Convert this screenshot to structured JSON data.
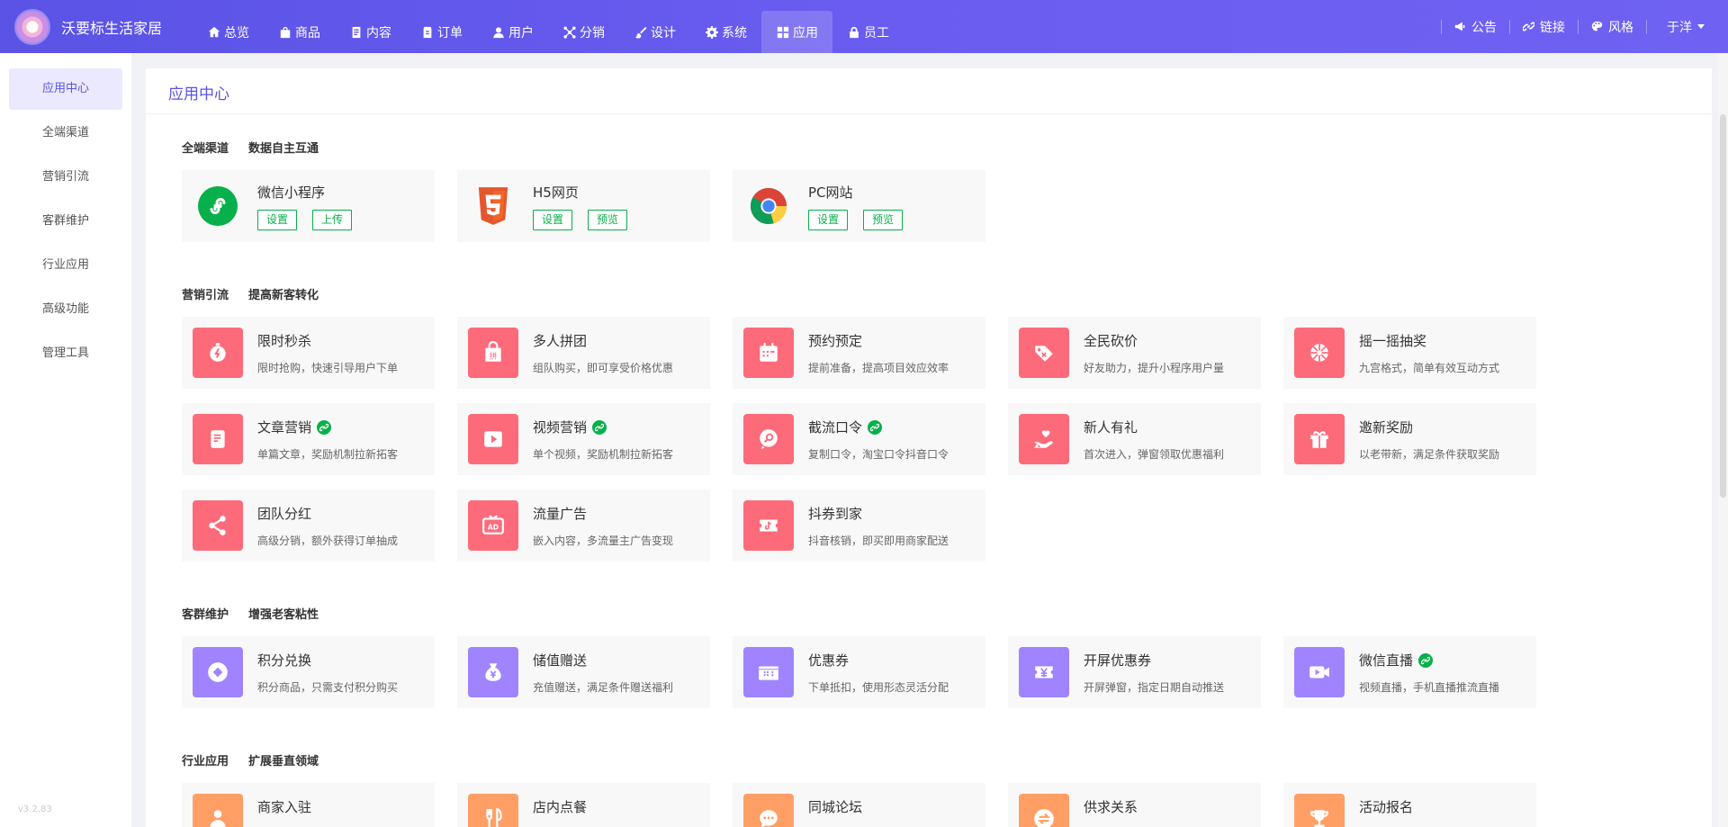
{
  "brand": {
    "name": "沃要标生活家居"
  },
  "nav": [
    {
      "label": "总览",
      "icon": "home-icon"
    },
    {
      "label": "商品",
      "icon": "bag-icon"
    },
    {
      "label": "内容",
      "icon": "document-icon"
    },
    {
      "label": "订单",
      "icon": "order-icon"
    },
    {
      "label": "用户",
      "icon": "user-icon"
    },
    {
      "label": "分销",
      "icon": "share-network-icon"
    },
    {
      "label": "设计",
      "icon": "brush-icon"
    },
    {
      "label": "系统",
      "icon": "gear-icon"
    },
    {
      "label": "应用",
      "icon": "grid-icon",
      "active": true
    },
    {
      "label": "员工",
      "icon": "lock-icon"
    }
  ],
  "tools": [
    {
      "label": "公告",
      "icon": "megaphone-icon"
    },
    {
      "label": "链接",
      "icon": "link-icon"
    },
    {
      "label": "风格",
      "icon": "palette-icon"
    }
  ],
  "user": {
    "name": "于洋"
  },
  "sidebar": {
    "items": [
      {
        "label": "应用中心",
        "active": true
      },
      {
        "label": "全端渠道"
      },
      {
        "label": "营销引流"
      },
      {
        "label": "客群维护"
      },
      {
        "label": "行业应用"
      },
      {
        "label": "高级功能"
      },
      {
        "label": "管理工具"
      }
    ],
    "version": "v3.2.83"
  },
  "panel": {
    "title": "应用中心"
  },
  "sections": [
    {
      "title": "全端渠道",
      "subtitle": "数据自主互通",
      "cards": [
        {
          "name": "微信小程序",
          "icon": "wechat-miniprogram-icon",
          "buttons": [
            "设置",
            "上传"
          ]
        },
        {
          "name": "H5网页",
          "icon": "html5-icon",
          "buttons": [
            "设置",
            "预览"
          ]
        },
        {
          "name": "PC网站",
          "icon": "chrome-icon",
          "buttons": [
            "设置",
            "预览"
          ]
        }
      ]
    },
    {
      "title": "营销引流",
      "subtitle": "提高新客转化",
      "cards": [
        {
          "name": "限时秒杀",
          "desc": "限时抢购，快速引导用户下单",
          "icon": "stopwatch-icon",
          "color": "#fd6b7b"
        },
        {
          "name": "多人拼团",
          "desc": "组队购买，即可享受价格优惠",
          "icon": "group-buy-icon",
          "color": "#fd6b7b"
        },
        {
          "name": "预约预定",
          "desc": "提前准备，提高项目效应效率",
          "icon": "calendar-icon",
          "color": "#fd6b7b"
        },
        {
          "name": "全民砍价",
          "desc": "好友助力，提升小程序用户量",
          "icon": "price-cut-icon",
          "color": "#fd6b7b"
        },
        {
          "name": "摇一摇抽奖",
          "desc": "九宫格式，简单有效互动方式",
          "icon": "lottery-wheel-icon",
          "color": "#fd6b7b"
        },
        {
          "name": "文章营销",
          "desc": "单篇文章，奖励机制拉新拓客",
          "icon": "article-icon",
          "color": "#fd6b7b",
          "linked": true
        },
        {
          "name": "视频营销",
          "desc": "单个视频，奖励机制拉新拓客",
          "icon": "video-icon",
          "color": "#fd6b7b",
          "linked": true
        },
        {
          "name": "截流口令",
          "desc": "复制口令，淘宝口令抖音口令",
          "icon": "search-bubble-icon",
          "color": "#fd6b7b",
          "linked": true
        },
        {
          "name": "新人有礼",
          "desc": "首次进入，弹窗领取优惠福利",
          "icon": "hand-heart-icon",
          "color": "#fd6b7b"
        },
        {
          "name": "邀新奖励",
          "desc": "以老带新，满足条件获取奖励",
          "icon": "gift-icon",
          "color": "#fd6b7b"
        },
        {
          "name": "团队分红",
          "desc": "高级分销，额外获得订单抽成",
          "icon": "share-icon",
          "color": "#fd6b7b"
        },
        {
          "name": "流量广告",
          "desc": "嵌入内容，多流量主广告变现",
          "icon": "ad-icon",
          "color": "#fd6b7b"
        },
        {
          "name": "抖券到家",
          "desc": "抖音核销，即买即用商家配送",
          "icon": "tiktok-ticket-icon",
          "color": "#fd6b7b"
        }
      ]
    },
    {
      "title": "客群维护",
      "subtitle": "增强老客粘性",
      "cards": [
        {
          "name": "积分兑换",
          "desc": "积分商品，只需支付积分购买",
          "icon": "points-icon",
          "color": "#a084ff"
        },
        {
          "name": "储值赠送",
          "desc": "充值赠送，满足条件赠送福利",
          "icon": "money-bag-icon",
          "color": "#a084ff"
        },
        {
          "name": "优惠券",
          "desc": "下单抵扣，使用形态灵活分配",
          "icon": "coupon-icon",
          "color": "#a084ff"
        },
        {
          "name": "开屏优惠券",
          "desc": "开屏弹窗，指定日期自动推送",
          "icon": "yuan-ticket-icon",
          "color": "#a084ff"
        },
        {
          "name": "微信直播",
          "desc": "视频直播，手机直播推流直播",
          "icon": "live-video-icon",
          "color": "#a084ff",
          "linked": true
        }
      ]
    },
    {
      "title": "行业应用",
      "subtitle": "扩展垂直领域",
      "cards": [
        {
          "name": "商家入驻",
          "icon": "merchant-icon",
          "color": "#ff9f66"
        },
        {
          "name": "店内点餐",
          "icon": "dining-icon",
          "color": "#ff9f66"
        },
        {
          "name": "同城论坛",
          "icon": "chat-icon",
          "color": "#ff9f66"
        },
        {
          "name": "供求关系",
          "icon": "exchange-icon",
          "color": "#ff9f66"
        },
        {
          "name": "活动报名",
          "icon": "trophy-icon",
          "color": "#ff9f66"
        }
      ]
    }
  ]
}
